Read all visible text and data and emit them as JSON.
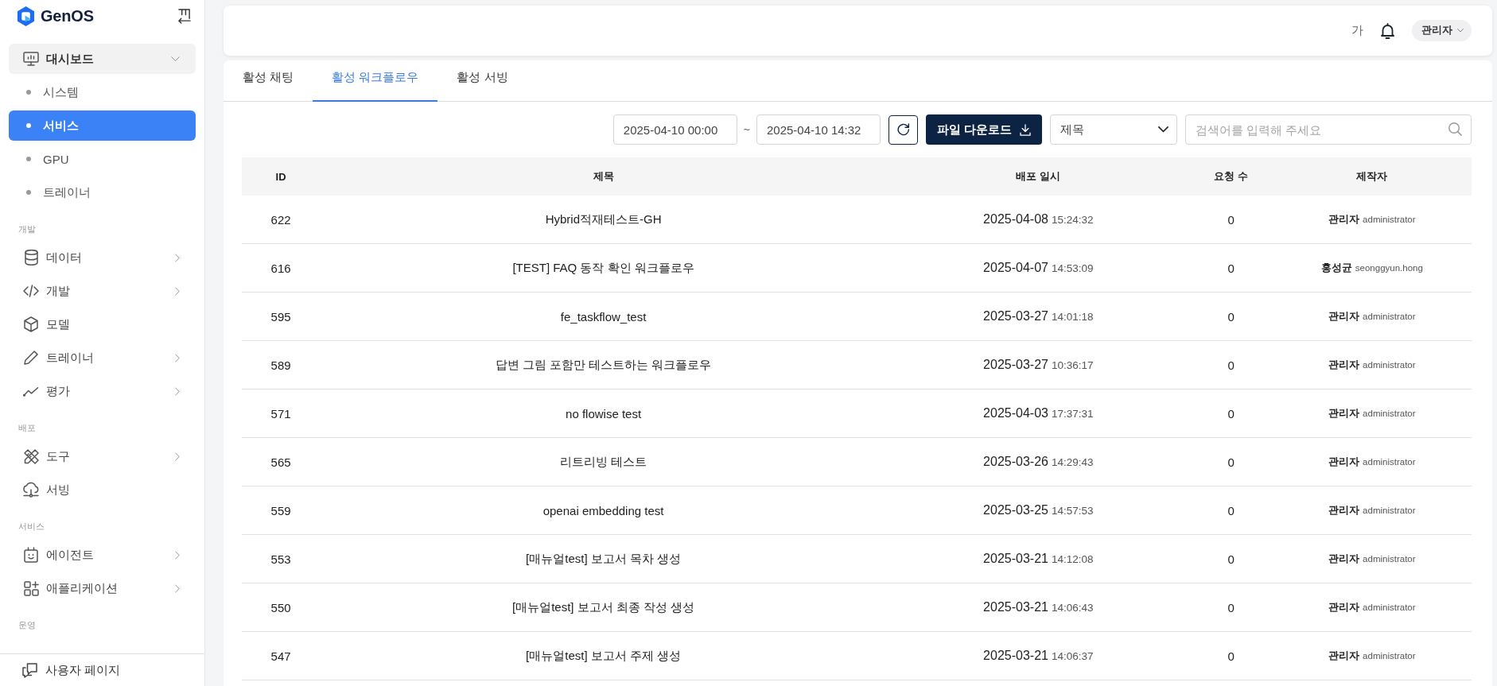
{
  "sidebar": {
    "logo": "GenOS",
    "nav": [
      {
        "kind": "group",
        "label": "대시보드",
        "selected": false,
        "expanded": true,
        "children": [
          {
            "label": "시스템",
            "selected": false
          },
          {
            "label": "서비스",
            "selected": true
          },
          {
            "label": "GPU",
            "selected": false
          },
          {
            "label": "트레이너",
            "selected": false
          }
        ]
      },
      {
        "kind": "section",
        "label": "개발"
      },
      {
        "kind": "group",
        "label": "데이터",
        "selected": false,
        "expanded": false
      },
      {
        "kind": "group",
        "label": "개발",
        "selected": false,
        "expanded": false
      },
      {
        "kind": "link",
        "label": "모델",
        "selected": false
      },
      {
        "kind": "group",
        "label": "트레이너",
        "selected": false,
        "expanded": false
      },
      {
        "kind": "group",
        "label": "평가",
        "selected": false,
        "expanded": false
      },
      {
        "kind": "section",
        "label": "배포"
      },
      {
        "kind": "group",
        "label": "도구",
        "selected": false,
        "expanded": false
      },
      {
        "kind": "link",
        "label": "서빙",
        "selected": false
      },
      {
        "kind": "section",
        "label": "서비스"
      },
      {
        "kind": "group",
        "label": "에이전트",
        "selected": false,
        "expanded": false
      },
      {
        "kind": "group",
        "label": "애플리케이션",
        "selected": false,
        "expanded": false
      },
      {
        "kind": "section",
        "label": "운영"
      }
    ],
    "footer_link": "사용자 페이지"
  },
  "header": {
    "font_size_button": "가",
    "user_menu": "관리자"
  },
  "tabs": [
    {
      "label": "활성 채팅",
      "selected": false
    },
    {
      "label": "활성 워크플로우",
      "selected": true
    },
    {
      "label": "활성 서빙",
      "selected": false
    }
  ],
  "toolbar": {
    "date_from": "2025-04-10 00:00",
    "range_separator": "~",
    "date_to": "2025-04-10 14:32",
    "download_button": "파일 다운로드",
    "filter_select": "제목",
    "search": {
      "placeholder": "검색어를 입력해 주세요"
    }
  },
  "table": {
    "columns": [
      "ID",
      "제목",
      "배포 일시",
      "요청 수",
      "제작자"
    ],
    "rows": [
      {
        "id": "622",
        "title": "Hybrid적재테스트-GH",
        "date": "2025-04-08",
        "time": "15:24:32",
        "requests": "0",
        "author": "관리자",
        "username": "administrator"
      },
      {
        "id": "616",
        "title": "[TEST] FAQ 동작 확인 워크플로우",
        "date": "2025-04-07",
        "time": "14:53:09",
        "requests": "0",
        "author": "홍성균",
        "username": "seonggyun.hong"
      },
      {
        "id": "595",
        "title": "fe_taskflow_test",
        "date": "2025-03-27",
        "time": "14:01:18",
        "requests": "0",
        "author": "관리자",
        "username": "administrator"
      },
      {
        "id": "589",
        "title": "답변 그림 포함만 테스트하는 워크플로우",
        "date": "2025-03-27",
        "time": "10:36:17",
        "requests": "0",
        "author": "관리자",
        "username": "administrator"
      },
      {
        "id": "571",
        "title": "no flowise test",
        "date": "2025-04-03",
        "time": "17:37:31",
        "requests": "0",
        "author": "관리자",
        "username": "administrator"
      },
      {
        "id": "565",
        "title": "리트리빙 테스트",
        "date": "2025-03-26",
        "time": "14:29:43",
        "requests": "0",
        "author": "관리자",
        "username": "administrator"
      },
      {
        "id": "559",
        "title": "openai embedding test",
        "date": "2025-03-25",
        "time": "14:57:53",
        "requests": "0",
        "author": "관리자",
        "username": "administrator"
      },
      {
        "id": "553",
        "title": "[매뉴얼test] 보고서 목차 생성",
        "date": "2025-03-21",
        "time": "14:12:08",
        "requests": "0",
        "author": "관리자",
        "username": "administrator"
      },
      {
        "id": "550",
        "title": "[매뉴얼test] 보고서 최종 작성 생성",
        "date": "2025-03-21",
        "time": "14:06:43",
        "requests": "0",
        "author": "관리자",
        "username": "administrator"
      },
      {
        "id": "547",
        "title": "[매뉴얼test] 보고서 주제 생성",
        "date": "2025-03-21",
        "time": "14:06:37",
        "requests": "0",
        "author": "관리자",
        "username": "administrator"
      }
    ]
  }
}
